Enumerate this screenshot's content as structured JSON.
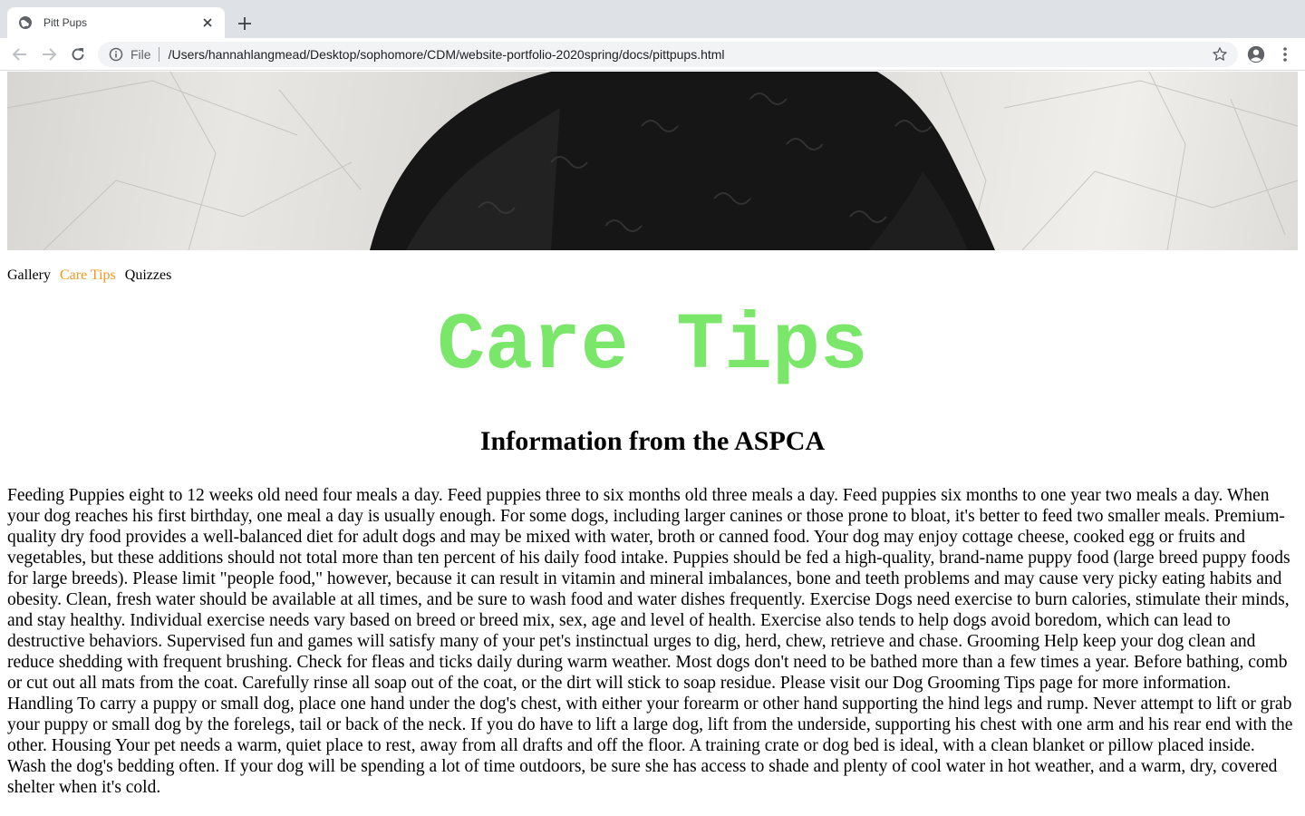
{
  "browser": {
    "tab": {
      "title": "Pitt Pups",
      "favicon": "globe-icon"
    },
    "address_bar": {
      "scheme_label": "File",
      "url": "/Users/hannahlangmead/Desktop/sophomore/CDM/website-portfolio-2020spring/docs/pittpups.html"
    },
    "icons": {
      "back": "arrow-left-icon",
      "forward": "arrow-right-icon",
      "reload": "reload-icon",
      "info": "info-icon",
      "bookmark": "star-icon",
      "profile": "account-circle-icon",
      "menu": "kebab-menu-icon",
      "new_tab": "plus-icon",
      "close_tab": "close-icon"
    }
  },
  "page": {
    "nav": [
      {
        "label": "Gallery",
        "active": false
      },
      {
        "label": "Care Tips",
        "active": true
      },
      {
        "label": "Quizzes",
        "active": false
      }
    ],
    "title": "Care Tips",
    "subtitle": "Information from the ASPCA",
    "body": "Feeding Puppies eight to 12 weeks old need four meals a day. Feed puppies three to six months old three meals a day. Feed puppies six months to one year two meals a day. When your dog reaches his first birthday, one meal a day is usually enough. For some dogs, including larger canines or those prone to bloat, it's better to feed two smaller meals. Premium-quality dry food provides a well-balanced diet for adult dogs and may be mixed with water, broth or canned food. Your dog may enjoy cottage cheese, cooked egg or fruits and vegetables, but these additions should not total more than ten percent of his daily food intake. Puppies should be fed a high-quality, brand-name puppy food (large breed puppy foods for large breeds). Please limit \"people food,\" however, because it can result in vitamin and mineral imbalances, bone and teeth problems and may cause very picky eating habits and obesity. Clean, fresh water should be available at all times, and be sure to wash food and water dishes frequently. Exercise Dogs need exercise to burn calories, stimulate their minds, and stay healthy. Individual exercise needs vary based on breed or breed mix, sex, age and level of health. Exercise also tends to help dogs avoid boredom, which can lead to destructive behaviors. Supervised fun and games will satisfy many of your pet's instinctual urges to dig, herd, chew, retrieve and chase. Grooming Help keep your dog clean and reduce shedding with frequent brushing. Check for fleas and ticks daily during warm weather. Most dogs don't need to be bathed more than a few times a year. Before bathing, comb or cut out all mats from the coat. Carefully rinse all soap out of the coat, or the dirt will stick to soap residue. Please visit our Dog Grooming Tips page for more information. Handling To carry a puppy or small dog, place one hand under the dog's chest, with either your forearm or other hand supporting the hind legs and rump. Never attempt to lift or grab your puppy or small dog by the forelegs, tail or back of the neck. If you do have to lift a large dog, lift from the underside, supporting his chest with one arm and his rear end with the other. Housing Your pet needs a warm, quiet place to rest, away from all drafts and off the floor. A training crate or dog bed is ideal, with a clean blanket or pillow placed inside. Wash the dog's bedding often. If your dog will be spending a lot of time outdoors, be sure she has access to shade and plenty of cool water in hot weather, and a warm, dry, covered shelter when it's cold."
  },
  "colors": {
    "title_green": "#7ae66a",
    "active_nav_orange": "#f5961e",
    "chrome_tabstrip": "#dee1e6",
    "omnibox_bg": "#f1f3f4"
  }
}
